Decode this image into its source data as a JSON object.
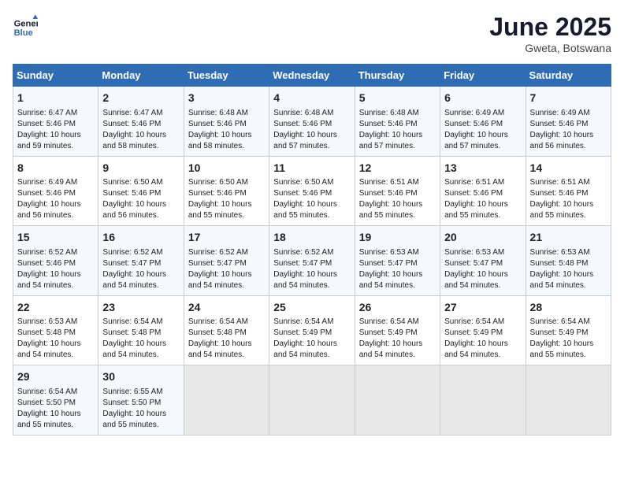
{
  "header": {
    "logo_line1": "General",
    "logo_line2": "Blue",
    "month_title": "June 2025",
    "location": "Gweta, Botswana"
  },
  "days_of_week": [
    "Sunday",
    "Monday",
    "Tuesday",
    "Wednesday",
    "Thursday",
    "Friday",
    "Saturday"
  ],
  "weeks": [
    [
      {
        "day": "1",
        "info": "Sunrise: 6:47 AM\nSunset: 5:46 PM\nDaylight: 10 hours\nand 59 minutes."
      },
      {
        "day": "2",
        "info": "Sunrise: 6:47 AM\nSunset: 5:46 PM\nDaylight: 10 hours\nand 58 minutes."
      },
      {
        "day": "3",
        "info": "Sunrise: 6:48 AM\nSunset: 5:46 PM\nDaylight: 10 hours\nand 58 minutes."
      },
      {
        "day": "4",
        "info": "Sunrise: 6:48 AM\nSunset: 5:46 PM\nDaylight: 10 hours\nand 57 minutes."
      },
      {
        "day": "5",
        "info": "Sunrise: 6:48 AM\nSunset: 5:46 PM\nDaylight: 10 hours\nand 57 minutes."
      },
      {
        "day": "6",
        "info": "Sunrise: 6:49 AM\nSunset: 5:46 PM\nDaylight: 10 hours\nand 57 minutes."
      },
      {
        "day": "7",
        "info": "Sunrise: 6:49 AM\nSunset: 5:46 PM\nDaylight: 10 hours\nand 56 minutes."
      }
    ],
    [
      {
        "day": "8",
        "info": "Sunrise: 6:49 AM\nSunset: 5:46 PM\nDaylight: 10 hours\nand 56 minutes."
      },
      {
        "day": "9",
        "info": "Sunrise: 6:50 AM\nSunset: 5:46 PM\nDaylight: 10 hours\nand 56 minutes."
      },
      {
        "day": "10",
        "info": "Sunrise: 6:50 AM\nSunset: 5:46 PM\nDaylight: 10 hours\nand 55 minutes."
      },
      {
        "day": "11",
        "info": "Sunrise: 6:50 AM\nSunset: 5:46 PM\nDaylight: 10 hours\nand 55 minutes."
      },
      {
        "day": "12",
        "info": "Sunrise: 6:51 AM\nSunset: 5:46 PM\nDaylight: 10 hours\nand 55 minutes."
      },
      {
        "day": "13",
        "info": "Sunrise: 6:51 AM\nSunset: 5:46 PM\nDaylight: 10 hours\nand 55 minutes."
      },
      {
        "day": "14",
        "info": "Sunrise: 6:51 AM\nSunset: 5:46 PM\nDaylight: 10 hours\nand 55 minutes."
      }
    ],
    [
      {
        "day": "15",
        "info": "Sunrise: 6:52 AM\nSunset: 5:46 PM\nDaylight: 10 hours\nand 54 minutes."
      },
      {
        "day": "16",
        "info": "Sunrise: 6:52 AM\nSunset: 5:47 PM\nDaylight: 10 hours\nand 54 minutes."
      },
      {
        "day": "17",
        "info": "Sunrise: 6:52 AM\nSunset: 5:47 PM\nDaylight: 10 hours\nand 54 minutes."
      },
      {
        "day": "18",
        "info": "Sunrise: 6:52 AM\nSunset: 5:47 PM\nDaylight: 10 hours\nand 54 minutes."
      },
      {
        "day": "19",
        "info": "Sunrise: 6:53 AM\nSunset: 5:47 PM\nDaylight: 10 hours\nand 54 minutes."
      },
      {
        "day": "20",
        "info": "Sunrise: 6:53 AM\nSunset: 5:47 PM\nDaylight: 10 hours\nand 54 minutes."
      },
      {
        "day": "21",
        "info": "Sunrise: 6:53 AM\nSunset: 5:48 PM\nDaylight: 10 hours\nand 54 minutes."
      }
    ],
    [
      {
        "day": "22",
        "info": "Sunrise: 6:53 AM\nSunset: 5:48 PM\nDaylight: 10 hours\nand 54 minutes."
      },
      {
        "day": "23",
        "info": "Sunrise: 6:54 AM\nSunset: 5:48 PM\nDaylight: 10 hours\nand 54 minutes."
      },
      {
        "day": "24",
        "info": "Sunrise: 6:54 AM\nSunset: 5:48 PM\nDaylight: 10 hours\nand 54 minutes."
      },
      {
        "day": "25",
        "info": "Sunrise: 6:54 AM\nSunset: 5:49 PM\nDaylight: 10 hours\nand 54 minutes."
      },
      {
        "day": "26",
        "info": "Sunrise: 6:54 AM\nSunset: 5:49 PM\nDaylight: 10 hours\nand 54 minutes."
      },
      {
        "day": "27",
        "info": "Sunrise: 6:54 AM\nSunset: 5:49 PM\nDaylight: 10 hours\nand 54 minutes."
      },
      {
        "day": "28",
        "info": "Sunrise: 6:54 AM\nSunset: 5:49 PM\nDaylight: 10 hours\nand 55 minutes."
      }
    ],
    [
      {
        "day": "29",
        "info": "Sunrise: 6:54 AM\nSunset: 5:50 PM\nDaylight: 10 hours\nand 55 minutes."
      },
      {
        "day": "30",
        "info": "Sunrise: 6:55 AM\nSunset: 5:50 PM\nDaylight: 10 hours\nand 55 minutes."
      },
      {
        "day": "",
        "info": ""
      },
      {
        "day": "",
        "info": ""
      },
      {
        "day": "",
        "info": ""
      },
      {
        "day": "",
        "info": ""
      },
      {
        "day": "",
        "info": ""
      }
    ]
  ]
}
